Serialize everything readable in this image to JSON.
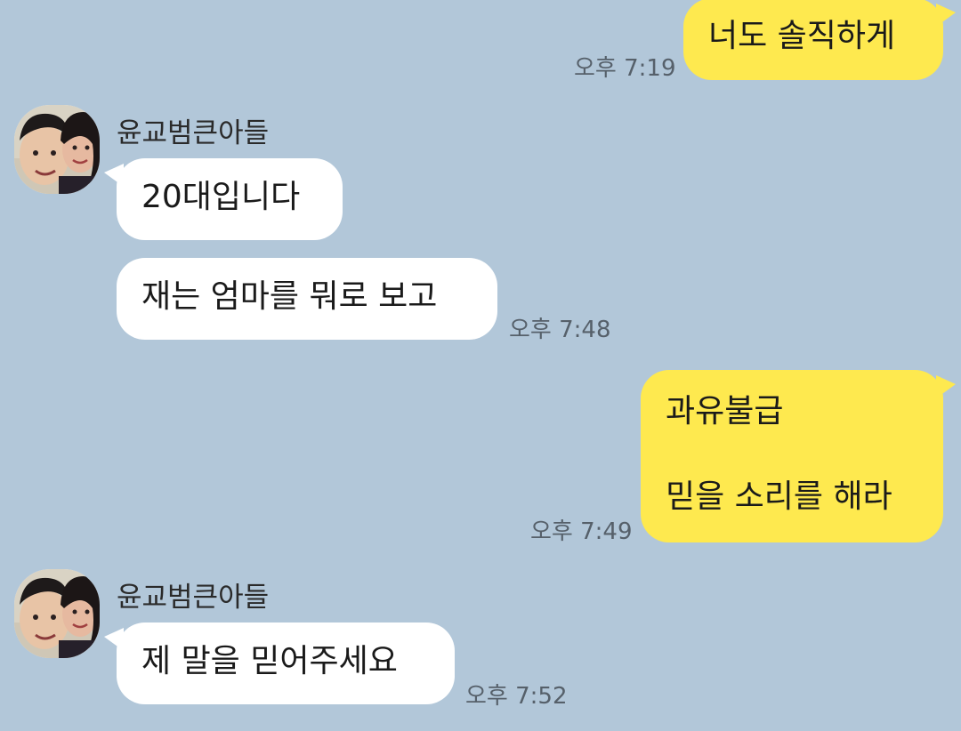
{
  "messages": [
    {
      "id": "m1",
      "side": "out",
      "text": "너도 솔직하게",
      "time": "오후 7:19"
    },
    {
      "id": "m2",
      "side": "in",
      "sender": "윤교범큰아들",
      "avatar_icon": "profile-photo-icon",
      "text": "20대입니다"
    },
    {
      "id": "m3",
      "side": "in",
      "text": "재는 엄마를 뭐로 보고",
      "time": "오후 7:48"
    },
    {
      "id": "m4",
      "side": "out",
      "text": "과유불급\n\n믿을 소리를 해라",
      "time": "오후 7:49"
    },
    {
      "id": "m5",
      "side": "in",
      "sender": "윤교범큰아들",
      "avatar_icon": "profile-photo-icon",
      "text": "제 말을 믿어주세요",
      "time": "오후 7:52"
    }
  ],
  "colors": {
    "background": "#b2c7d9",
    "incoming_bubble": "#ffffff",
    "outgoing_bubble": "#fee94f",
    "timestamp": "#56606a"
  }
}
